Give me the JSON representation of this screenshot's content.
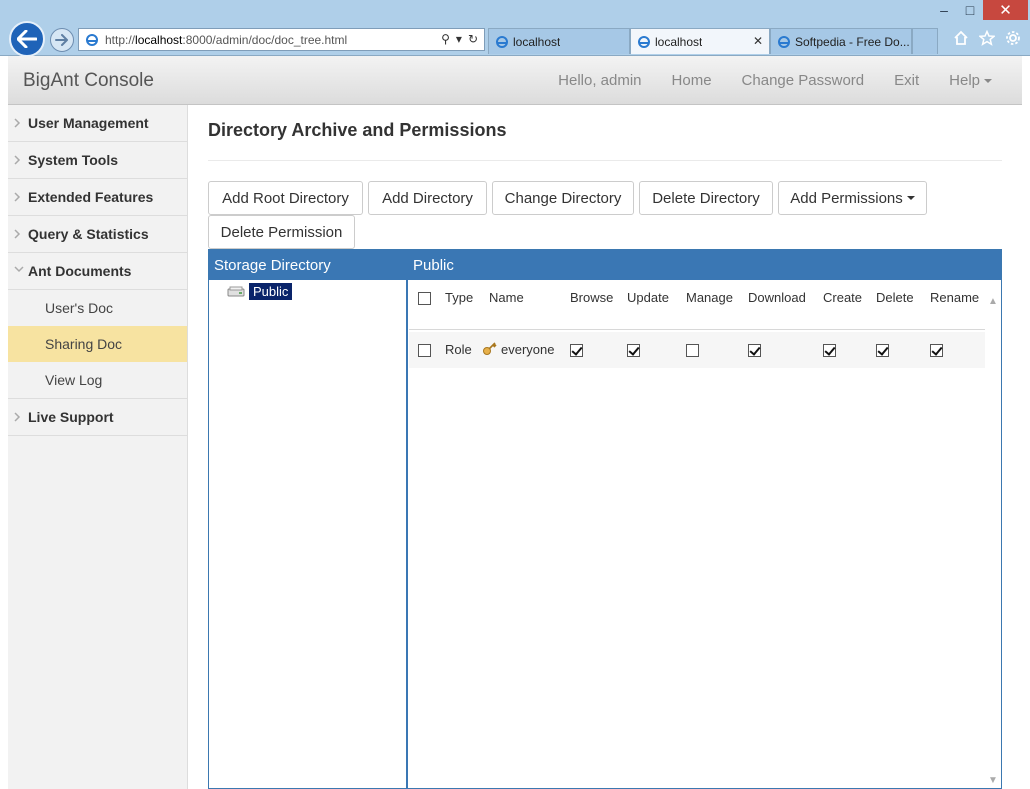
{
  "browser": {
    "address": {
      "prefix": "http://",
      "host": "localhost",
      "rest": ":8000/admin/doc/doc_tree.html"
    },
    "tabs": [
      {
        "label": "localhost",
        "active": false
      },
      {
        "label": "localhost",
        "active": true
      },
      {
        "label": "Softpedia - Free Do...",
        "active": false
      }
    ]
  },
  "navbar": {
    "brand": "BigAnt Console",
    "greeting": "Hello, admin",
    "home": "Home",
    "change_password": "Change Password",
    "exit": "Exit",
    "help": "Help"
  },
  "sidebar": {
    "items": [
      {
        "label": "User Management"
      },
      {
        "label": "System Tools"
      },
      {
        "label": "Extended Features"
      },
      {
        "label": "Query & Statistics"
      },
      {
        "label": "Ant Documents",
        "expanded": true
      }
    ],
    "subitems": [
      {
        "label": "User's Doc"
      },
      {
        "label": "Sharing Doc",
        "active": true
      },
      {
        "label": "View Log"
      }
    ],
    "live_support": "Live Support"
  },
  "main": {
    "title": "Directory Archive and Permissions",
    "buttons": {
      "add_root_directory": "Add Root Directory",
      "add_directory": "Add Directory",
      "change_directory": "Change Directory",
      "delete_directory": "Delete Directory",
      "add_permissions": "Add Permissions",
      "delete_permission": "Delete Permission"
    },
    "panel": {
      "left_header": "Storage Directory",
      "right_header": "Public",
      "tree_node": "Public",
      "columns": [
        "Type",
        "Name",
        "Browse",
        "Update",
        "Manage",
        "Download",
        "Create",
        "Delete",
        "Rename"
      ],
      "rows": [
        {
          "type": "Role",
          "name": "everyone",
          "browse": true,
          "update": true,
          "manage": false,
          "download": true,
          "create": true,
          "delete": true,
          "rename": true
        }
      ]
    }
  },
  "colors": {
    "panel_header": "#3a77b4",
    "sidebar_active": "#f7e3a1",
    "tree_selected": "#0a246a"
  }
}
